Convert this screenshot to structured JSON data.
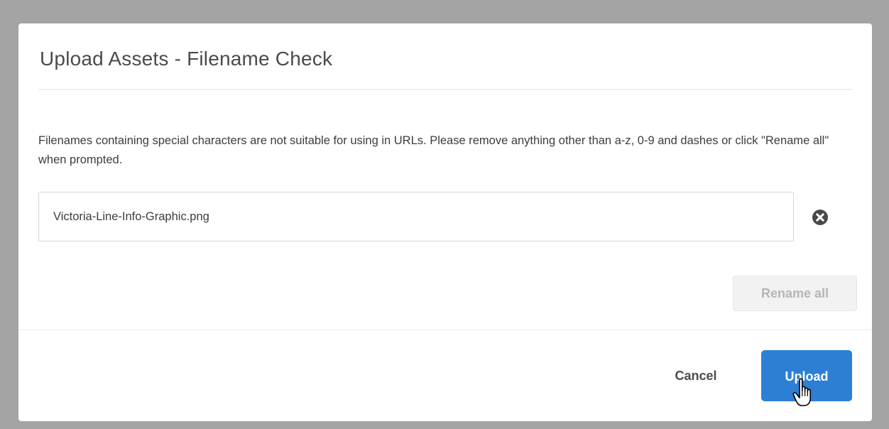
{
  "dialog": {
    "title": "Upload Assets - Filename Check",
    "message": "Filenames containing special characters are not suitable for using in URLs. Please remove anything other than a-z, 0-9 and dashes or click \"Rename all\" when prompted.",
    "filename_value": "Victoria-Line-Info-Graphic.png",
    "remove_icon": "close-circle-icon",
    "rename_all_label": "Rename all",
    "cancel_label": "Cancel",
    "upload_label": "Upload"
  },
  "colors": {
    "backdrop": "#a4a4a4",
    "primary_button": "#2d7fd6",
    "disabled_button_bg": "#f2f2f2",
    "disabled_button_text": "#b6b6b6"
  },
  "cursor": "hand-pointer-icon"
}
